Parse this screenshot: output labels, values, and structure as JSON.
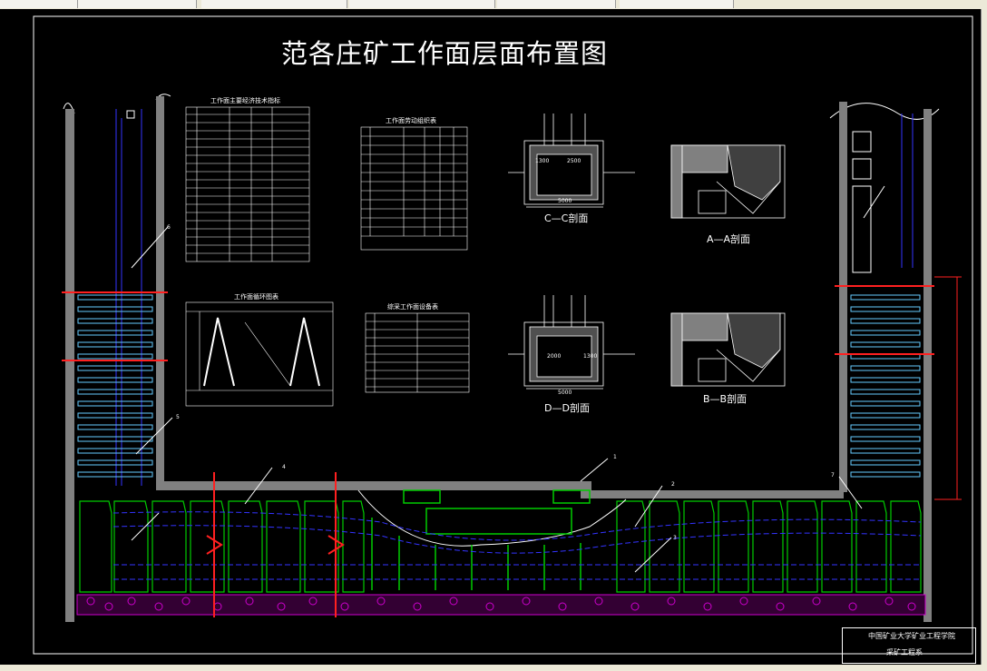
{
  "drawing": {
    "title": "范各庄矿工作面层面布置图",
    "tables": {
      "tech_indicators": "工作面主要经济技术指标",
      "labor": "工作面劳动组织表",
      "cycle": "工作面循环图表",
      "equipment": "综采工作面设备表"
    },
    "sections": {
      "cc": "C—C剖面",
      "aa": "A—A剖面",
      "dd": "D—D剖面",
      "bb": "B—B剖面"
    },
    "dims": {
      "cc_w1": "1300",
      "cc_w2": "2500",
      "cc_total": "5000",
      "dd_w1": "2000",
      "dd_w2": "1300",
      "dd_total": "5000"
    },
    "callouts": [
      "1",
      "2",
      "3",
      "4",
      "5",
      "6",
      "7"
    ],
    "title_block": {
      "school": "中国矿业大学矿业工程学院",
      "dept": "采矿工程系"
    }
  },
  "colors": {
    "background": "#000000",
    "lines": "#ffffff",
    "pillar": "#00cc00",
    "blue_lines": "#3333ff",
    "cyan_rows": "#66ccff",
    "red": "#ff2020",
    "gob": "#cc00cc",
    "roadway": "#808080"
  }
}
